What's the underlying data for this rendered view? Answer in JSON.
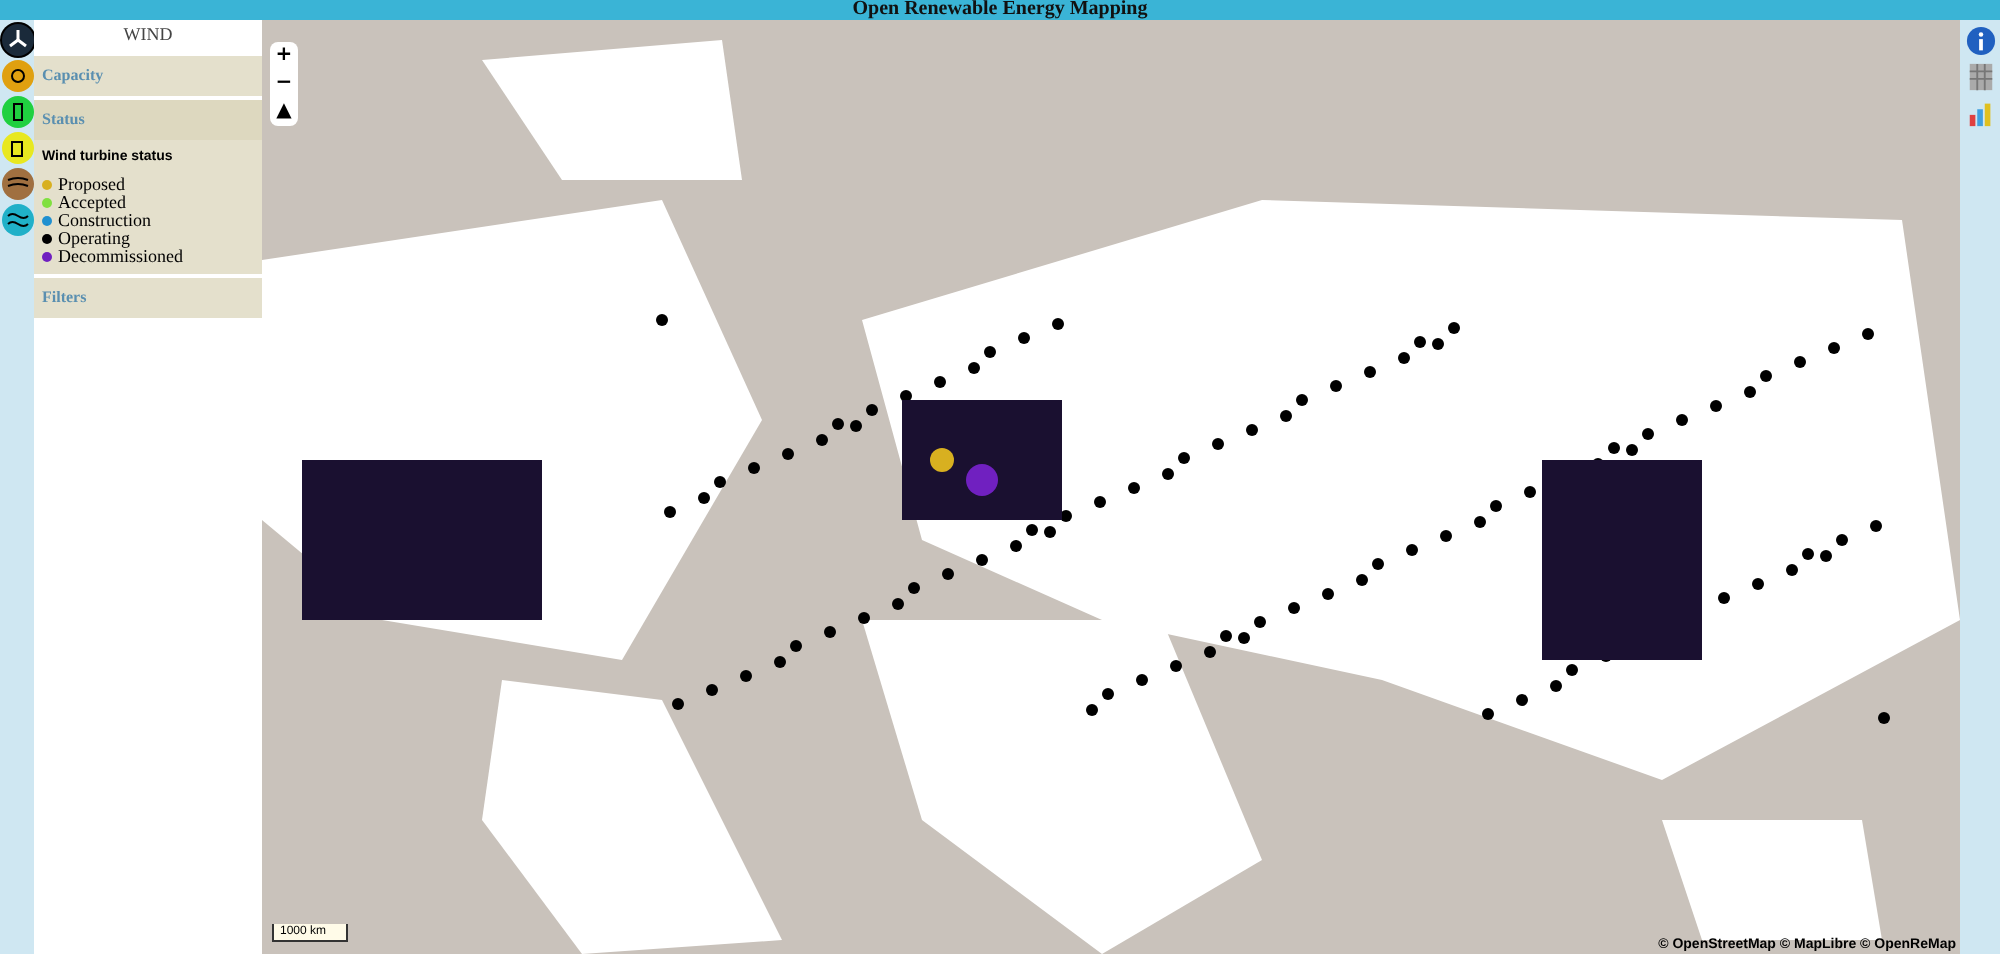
{
  "title": "Open Renewable Energy Mapping",
  "energy_types": [
    {
      "kind": "wind",
      "color": "#1a2a3a",
      "selected": true
    },
    {
      "kind": "solar",
      "color": "#e0a010",
      "selected": false
    },
    {
      "kind": "industry",
      "color": "#20d040",
      "selected": false
    },
    {
      "kind": "plant",
      "color": "#e8e820",
      "selected": false
    },
    {
      "kind": "biomass",
      "color": "#a07040",
      "selected": false
    },
    {
      "kind": "wave",
      "color": "#20b0c8",
      "selected": false
    }
  ],
  "sidebar": {
    "heading": "WIND",
    "sections": [
      {
        "label": "Capacity",
        "expanded": false
      },
      {
        "label": "Status",
        "expanded": true,
        "legend_title": "Wind turbine status",
        "legend": [
          {
            "label": "Proposed",
            "color": "#d8b020"
          },
          {
            "label": "Accepted",
            "color": "#80e040"
          },
          {
            "label": "Construction",
            "color": "#2090d0"
          },
          {
            "label": "Operating",
            "color": "#000000"
          },
          {
            "label": "Decommissioned",
            "color": "#7020c0"
          }
        ]
      },
      {
        "label": "Filters",
        "expanded": false
      }
    ]
  },
  "map": {
    "zoom_controls": [
      "+",
      "−",
      "▲"
    ],
    "scale": "1000 km",
    "attribution": "© OpenStreetMap © MapLibre © OpenReMap"
  }
}
